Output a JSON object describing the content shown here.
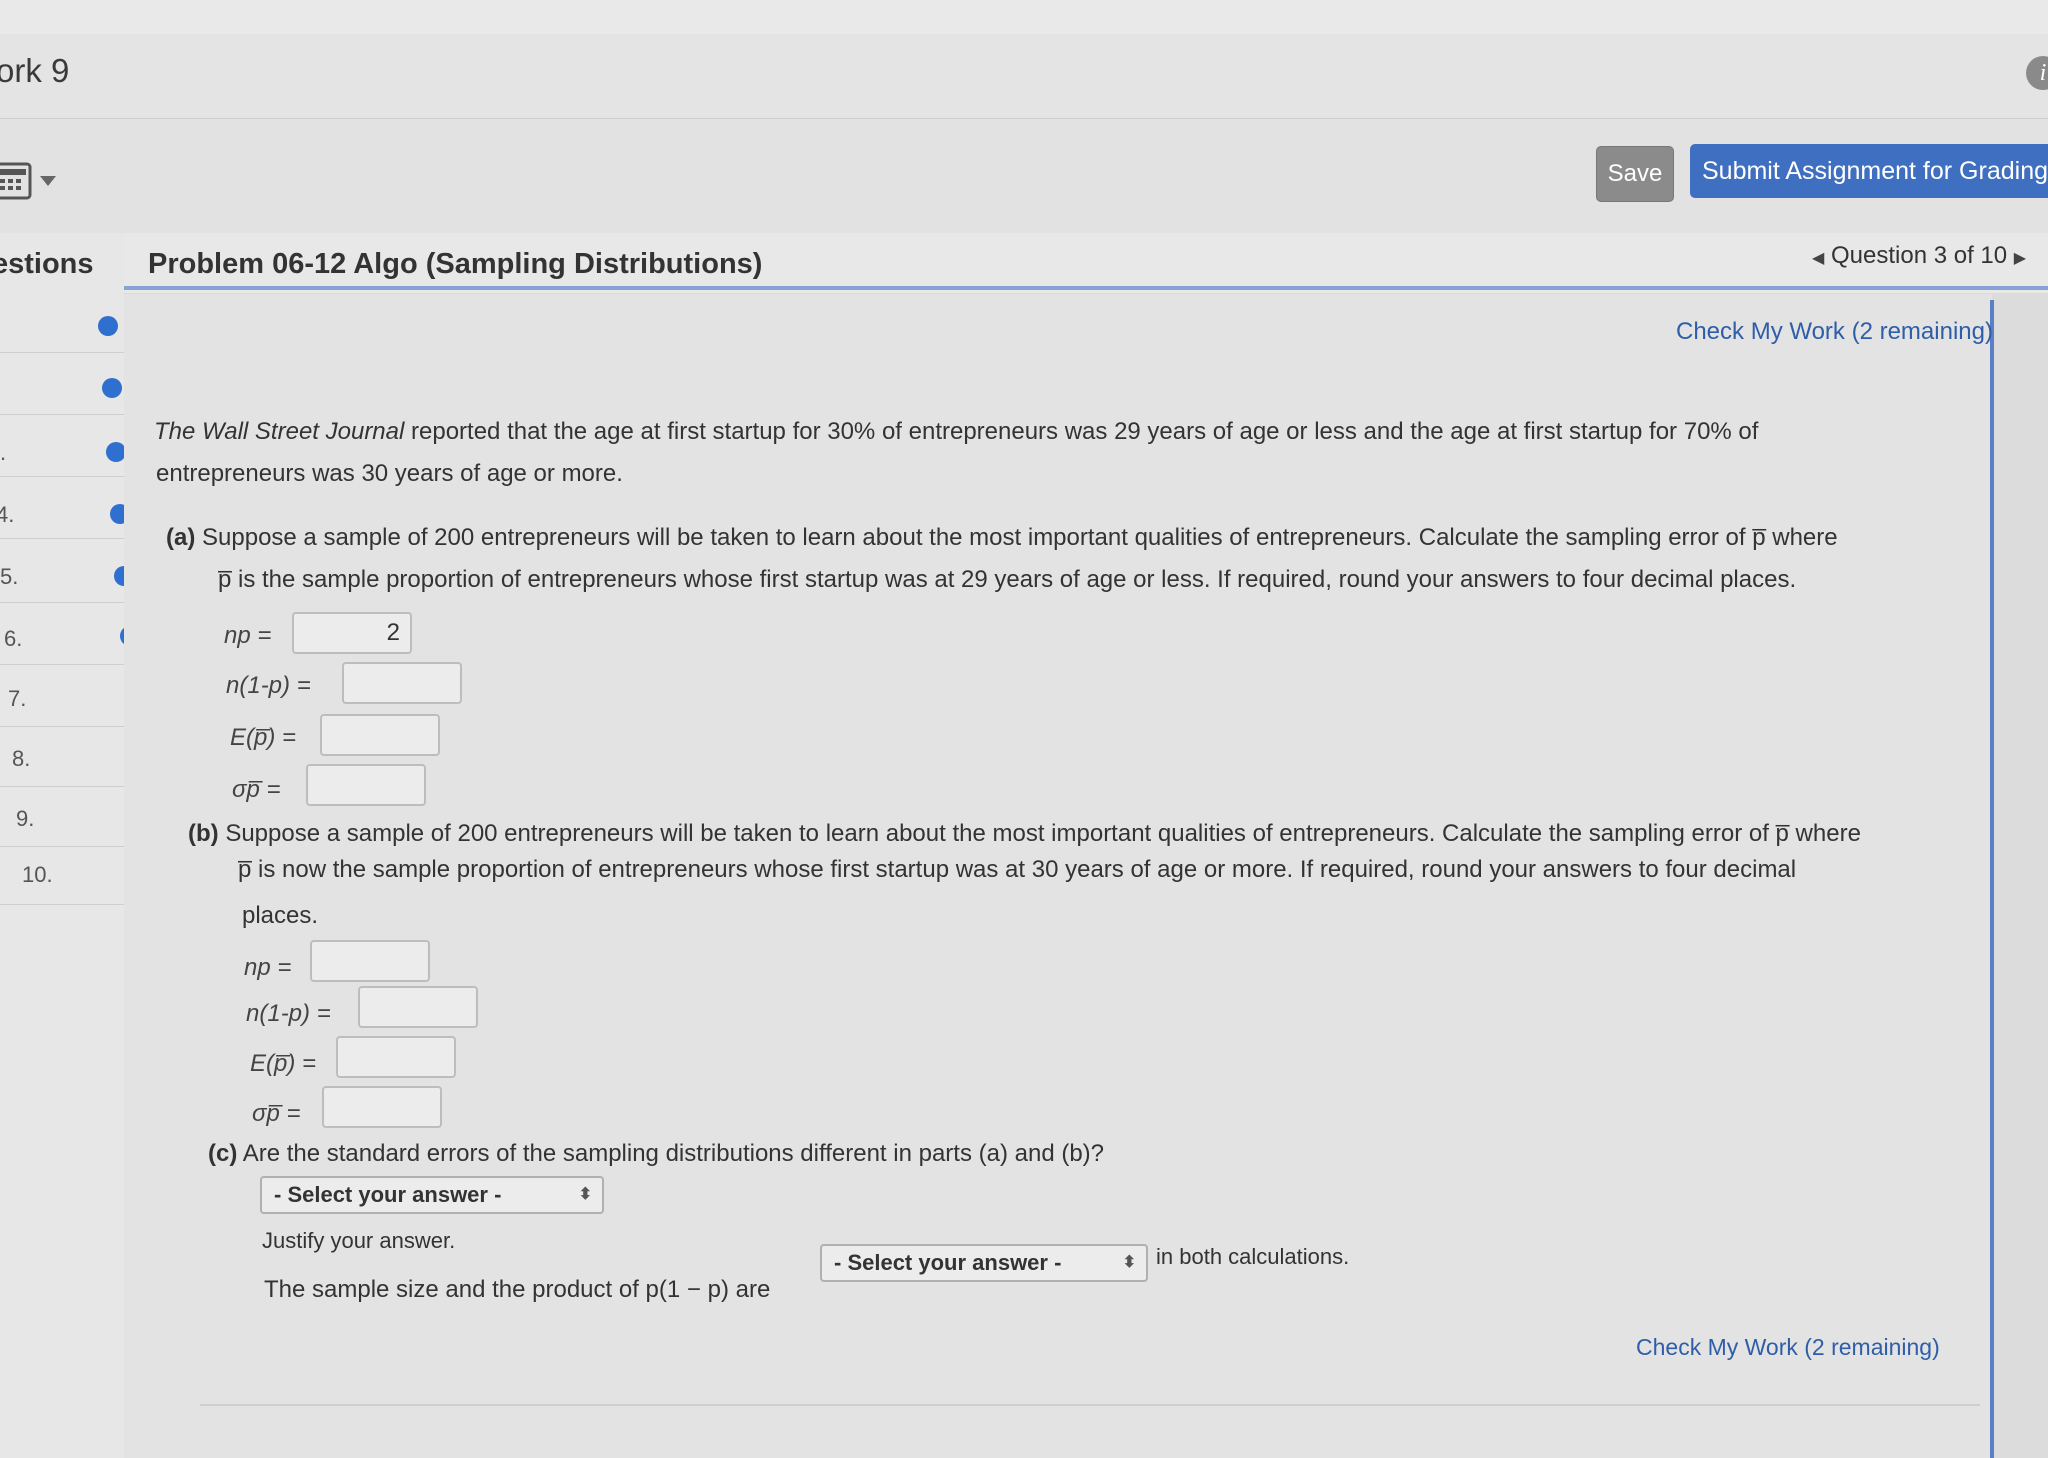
{
  "app": {
    "title": "ork 9",
    "info_icon": "i"
  },
  "toolbar": {
    "save_label": "Save",
    "submit_label": "Submit Assignment for Grading"
  },
  "sidebar": {
    "header": "estions",
    "items": [
      {
        "num": ""
      },
      {
        "num": ""
      },
      {
        "num": "."
      },
      {
        "num": "4."
      },
      {
        "num": "5."
      },
      {
        "num": "6."
      },
      {
        "num": "7."
      },
      {
        "num": "8."
      },
      {
        "num": "9."
      },
      {
        "num": "10."
      }
    ]
  },
  "question": {
    "title": "Problem 06-12 Algo (Sampling Distributions)",
    "nav": "Question 3 of 10",
    "check_top": "Check My Work (2 remaining)",
    "check_bottom": "Check My Work (2 remaining)"
  },
  "intro": {
    "line1_italic": "The Wall Street Journal",
    "line1_rest": " reported that the age at first startup for 30% of entrepreneurs was 29 years of age or less and the age at first startup for 70% of",
    "line2": "entrepreneurs was 30 years of age or more."
  },
  "part_a": {
    "tag": "(a)",
    "line1": " Suppose a sample of 200 entrepreneurs will be taken to learn about the most important qualities of entrepreneurs. Calculate the sampling error of p̅ where",
    "line2": "p̅ is the sample proportion of entrepreneurs whose first startup was at 29 years of age or less. If required, round your answers to four decimal places.",
    "labels": {
      "np": "np =",
      "nq": "n(1-p) =",
      "ep": "E(p̅) =",
      "sigma": "σp̅ ="
    },
    "values": {
      "np": "2",
      "nq": "",
      "ep": "",
      "sigma": ""
    }
  },
  "part_b": {
    "tag": "(b)",
    "line1": " Suppose a sample of 200 entrepreneurs will be taken to learn about the most important qualities of entrepreneurs. Calculate the sampling error of p̅ where",
    "line2": "p̅ is now the sample proportion of entrepreneurs whose first startup was at 30 years of age or more. If required, round your answers to four decimal",
    "line3": "places.",
    "labels": {
      "np": "np =",
      "nq": "n(1-p) =",
      "ep": "E(p̅) =",
      "sigma": "σp̅ ="
    },
    "values": {
      "np": "",
      "nq": "",
      "ep": "",
      "sigma": ""
    }
  },
  "part_c": {
    "tag": "(c)",
    "question": " Are the standard errors of the sampling distributions different in parts (a) and (b)?",
    "select1": "- Select your answer -",
    "justify": "Justify your answer.",
    "sentence_start": "The sample size and the product of p(1 − p) are",
    "select2": "- Select your answer -",
    "sentence_end": "in both calculations."
  }
}
